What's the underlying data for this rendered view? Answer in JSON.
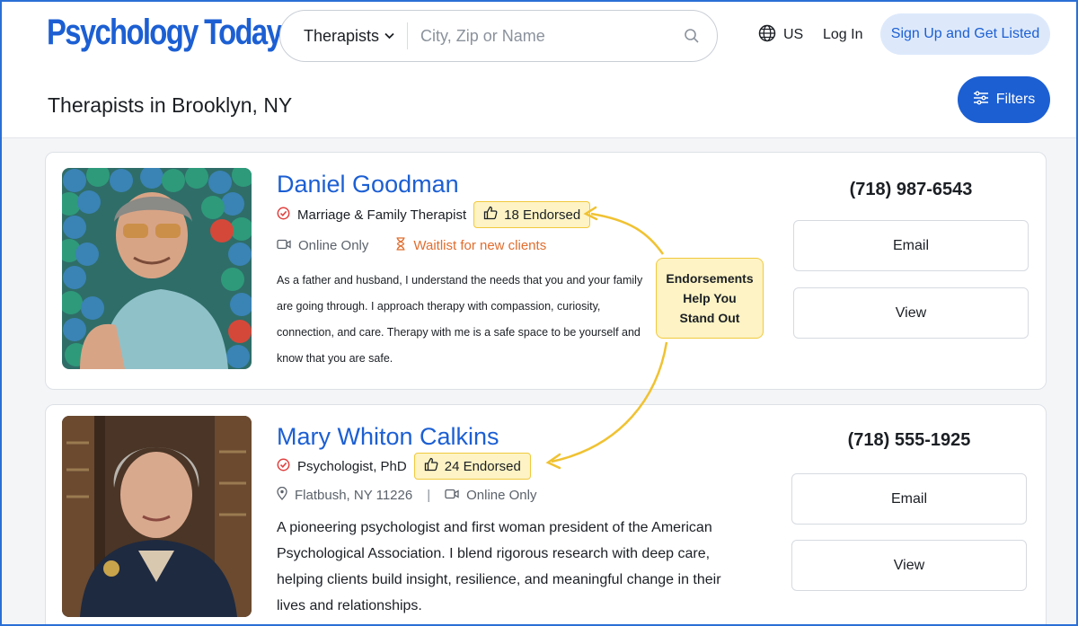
{
  "header": {
    "logo_text": "Psychology Today",
    "search": {
      "type_label": "Therapists",
      "placeholder": "City, Zip or Name"
    },
    "locale_label": "US",
    "login_label": "Log In",
    "signup_label": "Sign Up and Get Listed",
    "filters_label": "Filters"
  },
  "page_title": "Therapists in Brooklyn, NY",
  "callout": {
    "line1": "Endorsements",
    "line2": "Help You",
    "line3": "Stand Out"
  },
  "therapists": [
    {
      "name": "Daniel Goodman",
      "title": "Marriage & Family Therapist",
      "endorsed": "18 Endorsed",
      "mode": "Online Only",
      "waitlist": "Waitlist for new clients",
      "bio": "As a father and husband, I understand the needs that you and your family are going through. I approach therapy with compassion, curiosity, connection, and care. Therapy with me is a safe space to be yourself and know that you are safe.",
      "phone": "(718) 987-6543",
      "email_label": "Email",
      "view_label": "View"
    },
    {
      "name": "Mary Whiton Calkins",
      "title": "Psychologist, PhD",
      "endorsed": "24 Endorsed",
      "location": "Flatbush, NY 11226",
      "separator": "|",
      "mode": "Online Only",
      "bio": "A pioneering psychologist and first woman president of the American Psychological Association. I blend rigorous research with deep care, helping clients build insight, resilience, and meaningful change in their lives and relationships.",
      "phone": "(718) 555-1925",
      "email_label": "Email",
      "view_label": "View"
    }
  ],
  "colors": {
    "brand": "#1c5fd3",
    "endorse_bg": "#fdf3c4",
    "endorse_border": "#f1c93d",
    "waitlist": "#e16d2e",
    "verified": "#e0413f"
  }
}
